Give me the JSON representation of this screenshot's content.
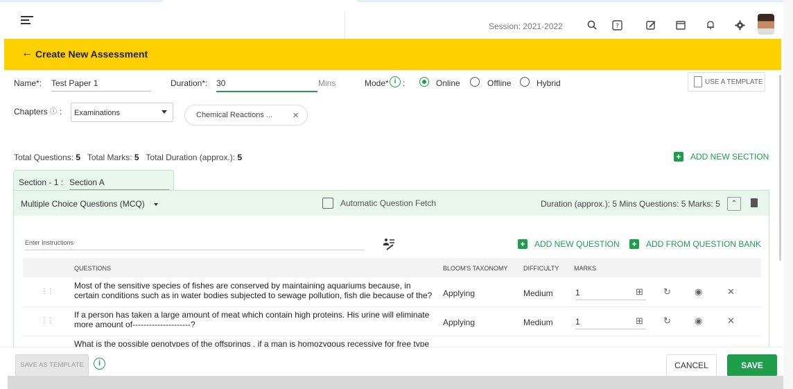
{
  "topbar": {
    "session_label": "Session: 2021-2022",
    "icons": [
      "search-icon",
      "help-icon",
      "edit-icon",
      "calendar-icon",
      "bell-icon",
      "gear-icon"
    ]
  },
  "header": {
    "back_arrow": "←",
    "title": "Create New Assessment"
  },
  "form": {
    "name_label": "Name*:",
    "name_value": "Test Paper 1",
    "duration_label": "Duration*:",
    "duration_value": "30",
    "duration_unit": "Mins",
    "mode_label": "Mode*",
    "mode_info": "i",
    "mode_colon": ":",
    "mode_options": [
      "Online",
      "Offline",
      "Hybrid"
    ],
    "mode_selected": "Online",
    "use_template_label": "USE A TEMPLATE",
    "chapters_label": "Chapters",
    "chapters_info": "ⓘ",
    "chapters_colon": ":",
    "chapters_dropdown": "Examinations",
    "chapter_chip": "Chemical Reactions ...",
    "chip_remove": "×"
  },
  "totals": {
    "questions_label": "Total Questions:",
    "questions_value": "5",
    "marks_label": "Total Marks:",
    "marks_value": "5",
    "duration_label": "Total Duration (approx.):",
    "duration_value": "5"
  },
  "add_section_label": "ADD NEW SECTION",
  "section": {
    "label": "Section - 1 :",
    "name_value": "Section A",
    "type_dropdown": "Multiple Choice Questions (MCQ)",
    "auto_fetch_label": "Automatic Question Fetch",
    "stats": "Duration (approx.): 5 Mins   Questions: 5   Marks: 5",
    "collapse_icon": "⌃",
    "instructions_placeholder": "Enter Instructions",
    "add_question_label": "ADD NEW QUESTION",
    "add_from_bank_label": "ADD FROM QUESTION BANK",
    "columns": {
      "questions": "QUESTIONS",
      "bloom": "BLOOM'S TAXONOMY",
      "difficulty": "DIFFICULTY",
      "marks": "MARKS"
    },
    "rows": [
      {
        "question": "Most of the sensitive species of fishes are conserved by maintaining aquariums because, in certain conditions such as in water bodies subjected to sewage pollution, fish die because of the?",
        "bloom": "Applying",
        "difficulty": "Medium",
        "marks": "1"
      },
      {
        "question": "If a person has taken a large amount of meat which contain high proteins. His urine will eliminate more amount of---------------------?",
        "bloom": "Applying",
        "difficulty": "Medium",
        "marks": "1"
      },
      {
        "question": "What is the possible genotypes of the offsprings , if a man is homozygous recessive for free type",
        "bloom": "",
        "difficulty": "",
        "marks": ""
      }
    ]
  },
  "footer": {
    "save_template_label": "SAVE AS TEMPLATE",
    "info_glyph": "i",
    "cancel_label": "CANCEL",
    "save_label": "SAVE"
  },
  "colors": {
    "accent_green": "#1e9e4a",
    "header_yellow": "#ffd000"
  }
}
